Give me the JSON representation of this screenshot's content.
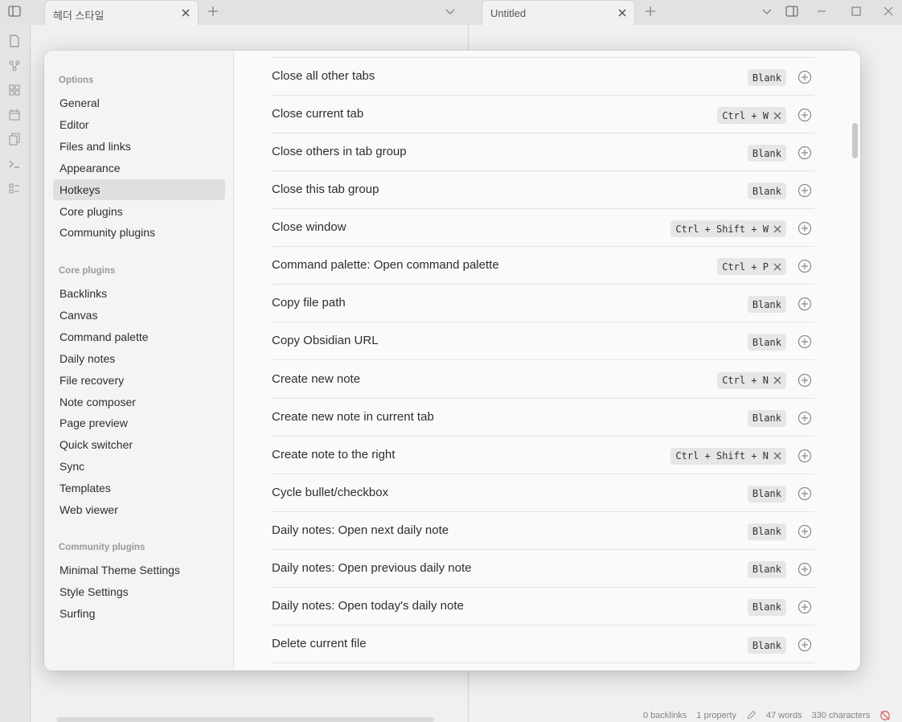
{
  "tabs": {
    "left_title": "헤더 스타일",
    "right_title": "Untitled"
  },
  "status": {
    "backlinks": "0 backlinks",
    "property": "1 property",
    "words": "47 words",
    "characters": "330 characters"
  },
  "sidebar": {
    "options_heading": "Options",
    "options": [
      "General",
      "Editor",
      "Files and links",
      "Appearance",
      "Hotkeys",
      "Core plugins",
      "Community plugins"
    ],
    "active": "Hotkeys",
    "core_heading": "Core plugins",
    "core": [
      "Backlinks",
      "Canvas",
      "Command palette",
      "Daily notes",
      "File recovery",
      "Note composer",
      "Page preview",
      "Quick switcher",
      "Sync",
      "Templates",
      "Web viewer"
    ],
    "community_heading": "Community plugins",
    "community": [
      "Minimal Theme Settings",
      "Style Settings",
      "Surfing"
    ]
  },
  "hotkeys": [
    {
      "label": "Close all other tabs",
      "keys": [
        "Blank"
      ],
      "removable": false
    },
    {
      "label": "Close current tab",
      "keys": [
        "Ctrl + W"
      ],
      "removable": true
    },
    {
      "label": "Close others in tab group",
      "keys": [
        "Blank"
      ],
      "removable": false
    },
    {
      "label": "Close this tab group",
      "keys": [
        "Blank"
      ],
      "removable": false
    },
    {
      "label": "Close window",
      "keys": [
        "Ctrl + Shift + W"
      ],
      "removable": true
    },
    {
      "label": "Command palette: Open command palette",
      "keys": [
        "Ctrl + P"
      ],
      "removable": true
    },
    {
      "label": "Copy file path",
      "keys": [
        "Blank"
      ],
      "removable": false
    },
    {
      "label": "Copy Obsidian URL",
      "keys": [
        "Blank"
      ],
      "removable": false
    },
    {
      "label": "Create new note",
      "keys": [
        "Ctrl + N"
      ],
      "removable": true
    },
    {
      "label": "Create new note in current tab",
      "keys": [
        "Blank"
      ],
      "removable": false
    },
    {
      "label": "Create note to the right",
      "keys": [
        "Ctrl + Shift + N"
      ],
      "removable": true
    },
    {
      "label": "Cycle bullet/checkbox",
      "keys": [
        "Blank"
      ],
      "removable": false
    },
    {
      "label": "Daily notes: Open next daily note",
      "keys": [
        "Blank"
      ],
      "removable": false
    },
    {
      "label": "Daily notes: Open previous daily note",
      "keys": [
        "Blank"
      ],
      "removable": false
    },
    {
      "label": "Daily notes: Open today's daily note",
      "keys": [
        "Blank"
      ],
      "removable": false
    },
    {
      "label": "Delete current file",
      "keys": [
        "Blank"
      ],
      "removable": false
    }
  ],
  "icons": {
    "add": "plus-circle-icon",
    "remove": "close-icon"
  }
}
